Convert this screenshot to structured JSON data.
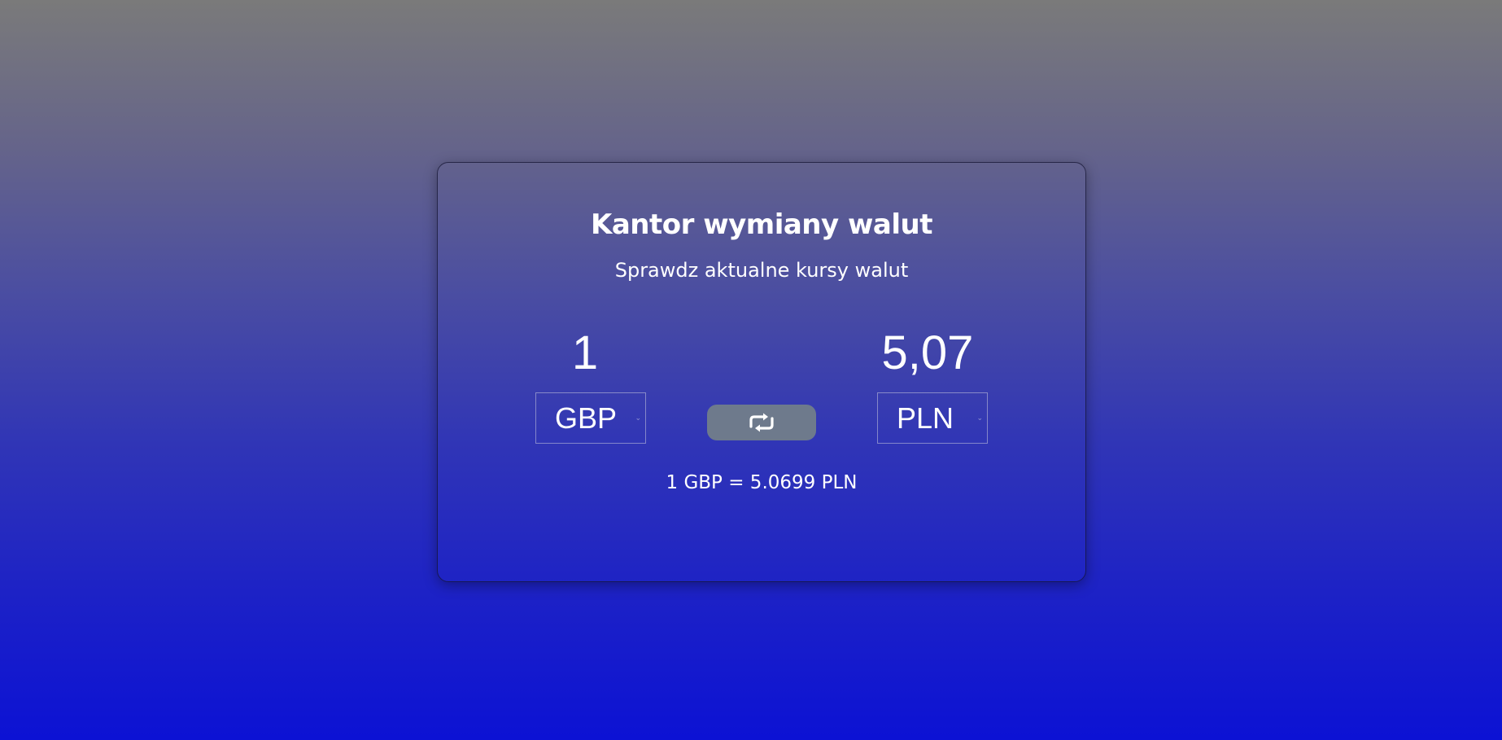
{
  "header": {
    "title": "Kantor wymiany walut",
    "subtitle": "Sprawdz aktualne kursy walut"
  },
  "converter": {
    "from_amount": "1",
    "from_currency": "GBP",
    "to_amount": "5,07",
    "to_currency": "PLN",
    "swap_icon": "swap-arrows-icon",
    "rate_text": "1 GBP = 5.0699 PLN"
  },
  "colors": {
    "background_top": "#7a7a7a",
    "background_bottom": "#0c12d4",
    "swap_button": "#6e7a8c",
    "text": "#ffffff"
  }
}
